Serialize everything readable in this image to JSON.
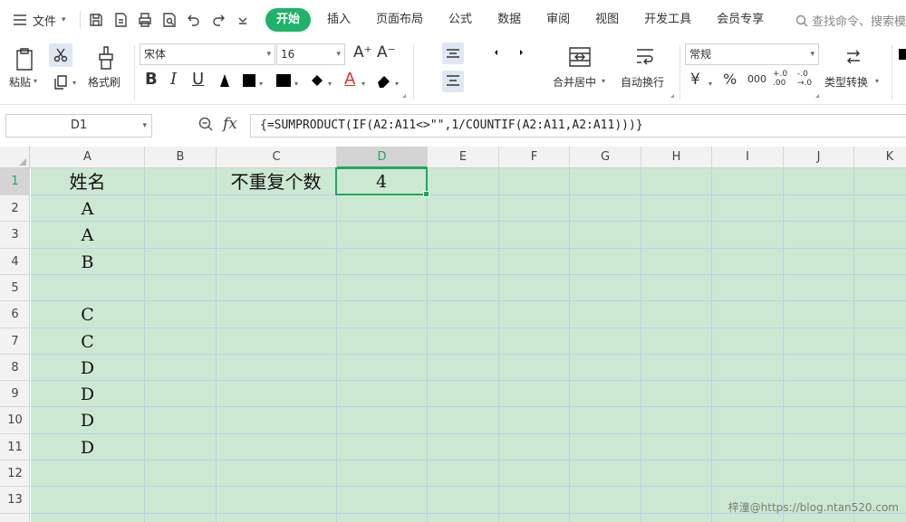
{
  "menubar": {
    "file_label": "文件",
    "tabs": [
      "开始",
      "插入",
      "页面布局",
      "公式",
      "数据",
      "审阅",
      "视图",
      "开发工具",
      "会员专享"
    ],
    "active_tab": "开始",
    "search_placeholder": "查找命令、搜索模"
  },
  "ribbon": {
    "paste_label": "粘贴",
    "format_painter_label": "格式刷",
    "font_name": "宋体",
    "font_size": "16",
    "merge_center_label": "合并居中",
    "wrap_text_label": "自动换行",
    "number_format": "常规",
    "convert_type_label": "类型转换",
    "bold_glyph": "B",
    "italic_glyph": "I",
    "underline_glyph": "U",
    "font_color_glyph": "A",
    "currency_glyph": "¥",
    "percent_glyph": "%",
    "thousands_glyph": "000",
    "inc_decimal_glyph": "+.0\n.00",
    "dec_decimal_glyph": "-.0\n→.0"
  },
  "formula_bar": {
    "name_box": "D1",
    "fx_label": "fx",
    "formula": "{=SUMPRODUCT(IF(A2:A11<>\"\",1/COUNTIF(A2:A11,A2:A11)))}"
  },
  "sheet": {
    "columns": [
      "A",
      "B",
      "C",
      "D",
      "E",
      "F",
      "G",
      "H",
      "I",
      "J",
      "K"
    ],
    "rows": [
      "1",
      "2",
      "3",
      "4",
      "5",
      "6",
      "7",
      "8",
      "9",
      "10",
      "11",
      "12",
      "13"
    ],
    "selected_cell": "D1",
    "cells": {
      "A1": "姓名",
      "C1": "不重复个数",
      "D1": "4",
      "A2": "A",
      "A3": "A",
      "A4": "B",
      "A5": "",
      "A6": "C",
      "A7": "C",
      "A8": "D",
      "A9": "D",
      "A10": "D",
      "A11": "D"
    },
    "background_color": "#cde8d2",
    "selection_color": "#1fa85e"
  },
  "watermark": "梓潼@https://blog.ntan520.com"
}
